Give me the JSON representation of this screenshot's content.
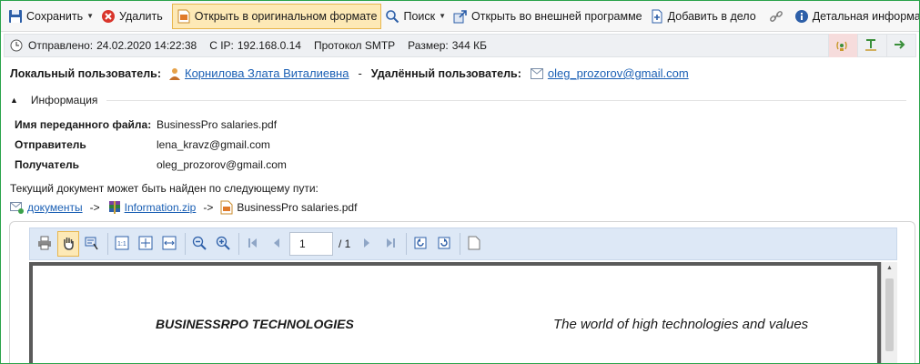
{
  "toolbar": {
    "save": "Сохранить",
    "delete": "Удалить",
    "open_original": "Открыть в оригинальном формате",
    "search": "Поиск",
    "open_external": "Открыть во внешней программе",
    "add_to_case": "Добавить в дело",
    "details": "Детальная информация"
  },
  "infobar": {
    "sent_label": "Отправлено:",
    "sent_value": "24.02.2020 14:22:38",
    "ip_label": "С IP:",
    "ip_value": "192.168.0.14",
    "protocol": "Протокол SMTP",
    "size_label": "Размер:",
    "size_value": "344 КБ"
  },
  "users": {
    "local_label": "Локальный пользователь:",
    "local_name": "Корнилова Злата Виталиевна",
    "dash": "-",
    "remote_label": "Удалённый пользователь:",
    "remote_email": "oleg_prozorov@gmail.com"
  },
  "info": {
    "header": "Информация",
    "rows": [
      {
        "key": "Имя переданного файла:",
        "value": "BusinessPro salaries.pdf"
      },
      {
        "key": "Отправитель",
        "value": "lena_kravz@gmail.com"
      },
      {
        "key": "Получатель",
        "value": "oleg_prozorov@gmail.com"
      }
    ]
  },
  "path": {
    "label": "Текущий документ может быть найден по следующему пути:",
    "segments": [
      "документы",
      "Information.zip",
      "BusinessPro salaries.pdf"
    ],
    "arrow": "->"
  },
  "pdf": {
    "page_value": "1",
    "page_total": "/ 1"
  },
  "document": {
    "company": "BUSINESSRPO TECHNOLOGIES",
    "tagline": "The world of high technologies and values"
  },
  "colors": {
    "accent_link": "#1a5fb4",
    "active_button_bg": "#fde9b6",
    "pdf_toolbar_bg": "#dde8f6",
    "frame_border": "#2aa34a"
  }
}
